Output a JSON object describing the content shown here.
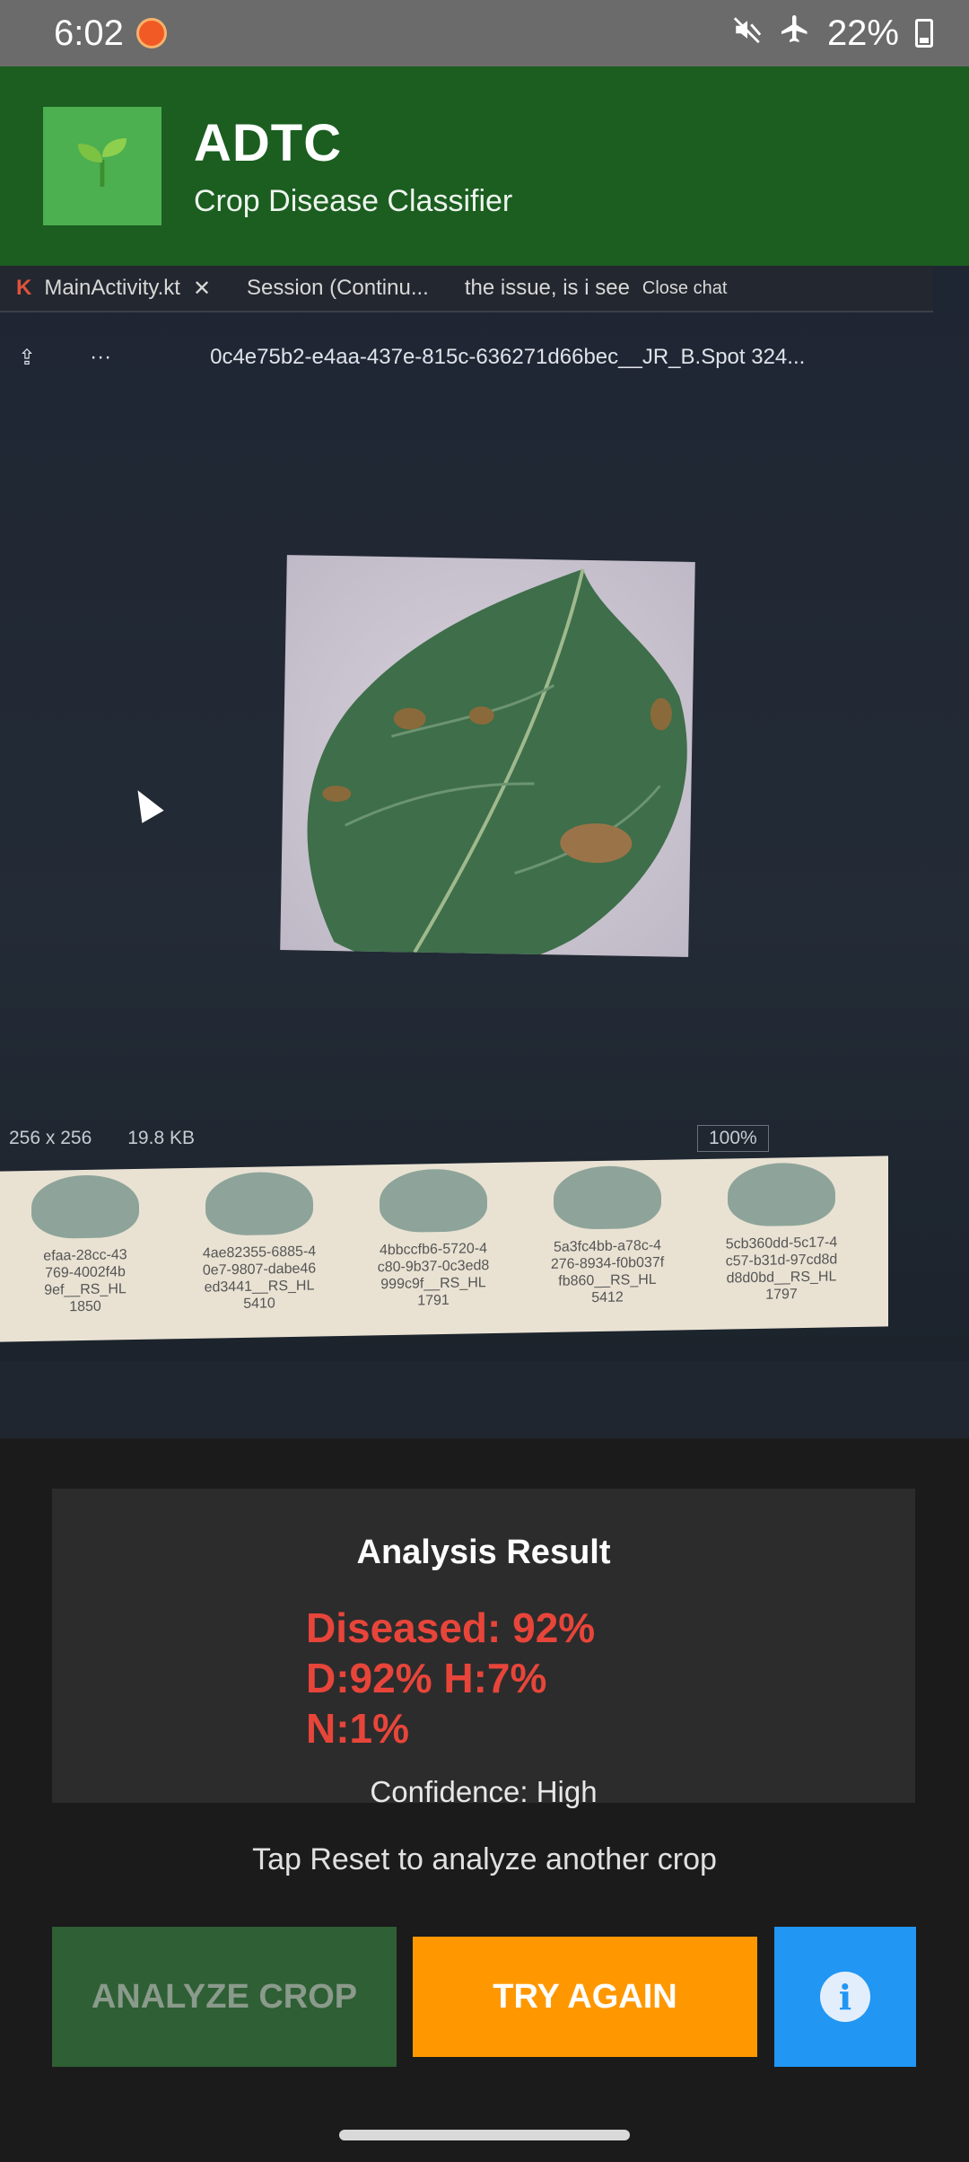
{
  "status_bar": {
    "time": "6:02",
    "battery": "22%"
  },
  "app_bar": {
    "title": "ADTC",
    "subtitle": "Crop Disease Classifier",
    "logo_icon": "seedling-icon"
  },
  "photo": {
    "tab_main": "MainActivity.kt",
    "tab_session": "Session (Continu...",
    "tab_issue": "the issue, is i see",
    "close_chat": "Close chat",
    "file_name": "0c4e75b2-e4aa-437e-815c-636271d66bec__JR_B.Spot 324...",
    "dimensions": "256 x 256",
    "file_size": "19.8 KB",
    "zoom": "100%",
    "thumbs": [
      {
        "line1": "efaa-28cc-43",
        "line2": "769-4002f4b",
        "line3": "9ef__RS_HL",
        "line4": "1850"
      },
      {
        "line1": "4ae82355-6885-4",
        "line2": "0e7-9807-dabe46",
        "line3": "ed3441__RS_HL",
        "line4": "5410"
      },
      {
        "line1": "4bbccfb6-5720-4",
        "line2": "c80-9b37-0c3ed8",
        "line3": "999c9f__RS_HL",
        "line4": "1791"
      },
      {
        "line1": "5a3fc4bb-a78c-4",
        "line2": "276-8934-f0b037f",
        "line3": "fb860__RS_HL",
        "line4": "5412"
      },
      {
        "line1": "5cb360dd-5c17-4",
        "line2": "c57-b31d-97cd8d",
        "line3": "d8d0bd__RS_HL",
        "line4": "1797"
      }
    ]
  },
  "result": {
    "title": "Analysis Result",
    "diagnosis": "Diseased: 92%",
    "breakdown": "D:92% H:7% N:1%",
    "confidence": "Confidence: High"
  },
  "hint": "Tap Reset to analyze another crop",
  "buttons": {
    "analyze": "ANALYZE CROP",
    "try_again": "TRY AGAIN",
    "info": "i"
  },
  "colors": {
    "app_bar": "#1b5e20",
    "diseased": "#e8453a",
    "try_again": "#ff9800",
    "info": "#2196f3",
    "analyze_disabled": "#2f5f34"
  }
}
